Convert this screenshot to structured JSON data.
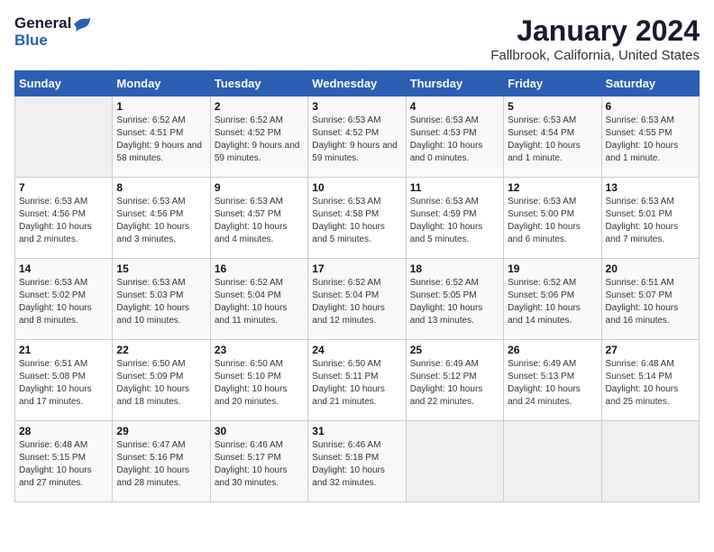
{
  "app": {
    "logo_line1": "General",
    "logo_line2": "Blue"
  },
  "header": {
    "title": "January 2024",
    "subtitle": "Fallbrook, California, United States"
  },
  "calendar": {
    "days_of_week": [
      "Sunday",
      "Monday",
      "Tuesday",
      "Wednesday",
      "Thursday",
      "Friday",
      "Saturday"
    ],
    "weeks": [
      [
        {
          "num": "",
          "sunrise": "",
          "sunset": "",
          "daylight": "",
          "empty": true
        },
        {
          "num": "1",
          "sunrise": "Sunrise: 6:52 AM",
          "sunset": "Sunset: 4:51 PM",
          "daylight": "Daylight: 9 hours and 58 minutes."
        },
        {
          "num": "2",
          "sunrise": "Sunrise: 6:52 AM",
          "sunset": "Sunset: 4:52 PM",
          "daylight": "Daylight: 9 hours and 59 minutes."
        },
        {
          "num": "3",
          "sunrise": "Sunrise: 6:53 AM",
          "sunset": "Sunset: 4:52 PM",
          "daylight": "Daylight: 9 hours and 59 minutes."
        },
        {
          "num": "4",
          "sunrise": "Sunrise: 6:53 AM",
          "sunset": "Sunset: 4:53 PM",
          "daylight": "Daylight: 10 hours and 0 minutes."
        },
        {
          "num": "5",
          "sunrise": "Sunrise: 6:53 AM",
          "sunset": "Sunset: 4:54 PM",
          "daylight": "Daylight: 10 hours and 1 minute."
        },
        {
          "num": "6",
          "sunrise": "Sunrise: 6:53 AM",
          "sunset": "Sunset: 4:55 PM",
          "daylight": "Daylight: 10 hours and 1 minute."
        }
      ],
      [
        {
          "num": "7",
          "sunrise": "Sunrise: 6:53 AM",
          "sunset": "Sunset: 4:56 PM",
          "daylight": "Daylight: 10 hours and 2 minutes."
        },
        {
          "num": "8",
          "sunrise": "Sunrise: 6:53 AM",
          "sunset": "Sunset: 4:56 PM",
          "daylight": "Daylight: 10 hours and 3 minutes."
        },
        {
          "num": "9",
          "sunrise": "Sunrise: 6:53 AM",
          "sunset": "Sunset: 4:57 PM",
          "daylight": "Daylight: 10 hours and 4 minutes."
        },
        {
          "num": "10",
          "sunrise": "Sunrise: 6:53 AM",
          "sunset": "Sunset: 4:58 PM",
          "daylight": "Daylight: 10 hours and 5 minutes."
        },
        {
          "num": "11",
          "sunrise": "Sunrise: 6:53 AM",
          "sunset": "Sunset: 4:59 PM",
          "daylight": "Daylight: 10 hours and 5 minutes."
        },
        {
          "num": "12",
          "sunrise": "Sunrise: 6:53 AM",
          "sunset": "Sunset: 5:00 PM",
          "daylight": "Daylight: 10 hours and 6 minutes."
        },
        {
          "num": "13",
          "sunrise": "Sunrise: 6:53 AM",
          "sunset": "Sunset: 5:01 PM",
          "daylight": "Daylight: 10 hours and 7 minutes."
        }
      ],
      [
        {
          "num": "14",
          "sunrise": "Sunrise: 6:53 AM",
          "sunset": "Sunset: 5:02 PM",
          "daylight": "Daylight: 10 hours and 8 minutes."
        },
        {
          "num": "15",
          "sunrise": "Sunrise: 6:53 AM",
          "sunset": "Sunset: 5:03 PM",
          "daylight": "Daylight: 10 hours and 10 minutes."
        },
        {
          "num": "16",
          "sunrise": "Sunrise: 6:52 AM",
          "sunset": "Sunset: 5:04 PM",
          "daylight": "Daylight: 10 hours and 11 minutes."
        },
        {
          "num": "17",
          "sunrise": "Sunrise: 6:52 AM",
          "sunset": "Sunset: 5:04 PM",
          "daylight": "Daylight: 10 hours and 12 minutes."
        },
        {
          "num": "18",
          "sunrise": "Sunrise: 6:52 AM",
          "sunset": "Sunset: 5:05 PM",
          "daylight": "Daylight: 10 hours and 13 minutes."
        },
        {
          "num": "19",
          "sunrise": "Sunrise: 6:52 AM",
          "sunset": "Sunset: 5:06 PM",
          "daylight": "Daylight: 10 hours and 14 minutes."
        },
        {
          "num": "20",
          "sunrise": "Sunrise: 6:51 AM",
          "sunset": "Sunset: 5:07 PM",
          "daylight": "Daylight: 10 hours and 16 minutes."
        }
      ],
      [
        {
          "num": "21",
          "sunrise": "Sunrise: 6:51 AM",
          "sunset": "Sunset: 5:08 PM",
          "daylight": "Daylight: 10 hours and 17 minutes."
        },
        {
          "num": "22",
          "sunrise": "Sunrise: 6:50 AM",
          "sunset": "Sunset: 5:09 PM",
          "daylight": "Daylight: 10 hours and 18 minutes."
        },
        {
          "num": "23",
          "sunrise": "Sunrise: 6:50 AM",
          "sunset": "Sunset: 5:10 PM",
          "daylight": "Daylight: 10 hours and 20 minutes."
        },
        {
          "num": "24",
          "sunrise": "Sunrise: 6:50 AM",
          "sunset": "Sunset: 5:11 PM",
          "daylight": "Daylight: 10 hours and 21 minutes."
        },
        {
          "num": "25",
          "sunrise": "Sunrise: 6:49 AM",
          "sunset": "Sunset: 5:12 PM",
          "daylight": "Daylight: 10 hours and 22 minutes."
        },
        {
          "num": "26",
          "sunrise": "Sunrise: 6:49 AM",
          "sunset": "Sunset: 5:13 PM",
          "daylight": "Daylight: 10 hours and 24 minutes."
        },
        {
          "num": "27",
          "sunrise": "Sunrise: 6:48 AM",
          "sunset": "Sunset: 5:14 PM",
          "daylight": "Daylight: 10 hours and 25 minutes."
        }
      ],
      [
        {
          "num": "28",
          "sunrise": "Sunrise: 6:48 AM",
          "sunset": "Sunset: 5:15 PM",
          "daylight": "Daylight: 10 hours and 27 minutes."
        },
        {
          "num": "29",
          "sunrise": "Sunrise: 6:47 AM",
          "sunset": "Sunset: 5:16 PM",
          "daylight": "Daylight: 10 hours and 28 minutes."
        },
        {
          "num": "30",
          "sunrise": "Sunrise: 6:46 AM",
          "sunset": "Sunset: 5:17 PM",
          "daylight": "Daylight: 10 hours and 30 minutes."
        },
        {
          "num": "31",
          "sunrise": "Sunrise: 6:46 AM",
          "sunset": "Sunset: 5:18 PM",
          "daylight": "Daylight: 10 hours and 32 minutes."
        },
        {
          "num": "",
          "sunrise": "",
          "sunset": "",
          "daylight": "",
          "empty": true
        },
        {
          "num": "",
          "sunrise": "",
          "sunset": "",
          "daylight": "",
          "empty": true
        },
        {
          "num": "",
          "sunrise": "",
          "sunset": "",
          "daylight": "",
          "empty": true
        }
      ]
    ]
  }
}
